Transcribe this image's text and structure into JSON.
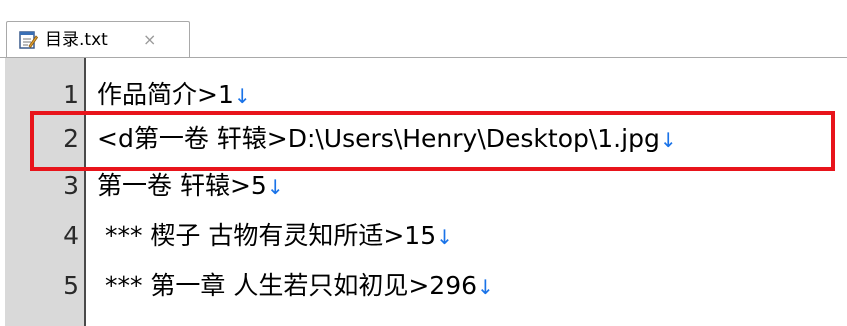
{
  "tab": {
    "icon": "notepad-icon",
    "title": "目录.txt",
    "close": "×"
  },
  "lines": [
    {
      "number": "1",
      "text": "作品简介>1",
      "eol": "↓"
    },
    {
      "number": "2",
      "text": "<d第一卷 轩辕>D:\\Users\\Henry\\Desktop\\1.jpg",
      "eol": "↓"
    },
    {
      "number": "3",
      "text": "第一卷 轩辕>5",
      "eol": "↓"
    },
    {
      "number": "4",
      "text": " *** 楔子 古物有灵知所适>15",
      "eol": "↓"
    },
    {
      "number": "5",
      "text": " *** 第一章 人生若只如初见>296",
      "eol": "↓"
    }
  ],
  "highlight_color": "#e8141b",
  "eol_color": "#1a73e8"
}
